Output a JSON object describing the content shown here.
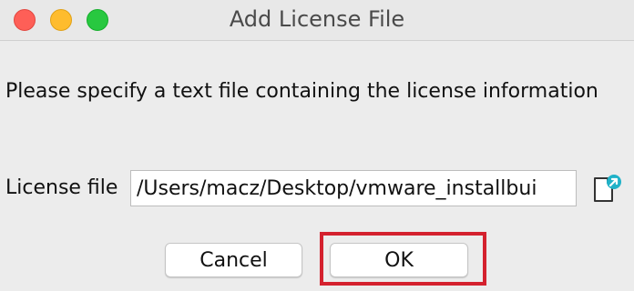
{
  "window": {
    "title": "Add License File",
    "controls": [
      "close",
      "minimize",
      "zoom"
    ]
  },
  "dialog": {
    "prompt": "Please specify a text file containing the license information",
    "license_field": {
      "label": "License file",
      "value": "/Users/macz/Desktop/vmware_installbui"
    },
    "browse_icon": "file-browse-icon"
  },
  "buttons": {
    "cancel_label": "Cancel",
    "ok_label": "OK"
  },
  "colors": {
    "close": "#fe5f57",
    "minimize": "#febc2e",
    "zoom": "#28c840",
    "highlight": "#d4212e",
    "icon_accent": "#20b2c8"
  }
}
